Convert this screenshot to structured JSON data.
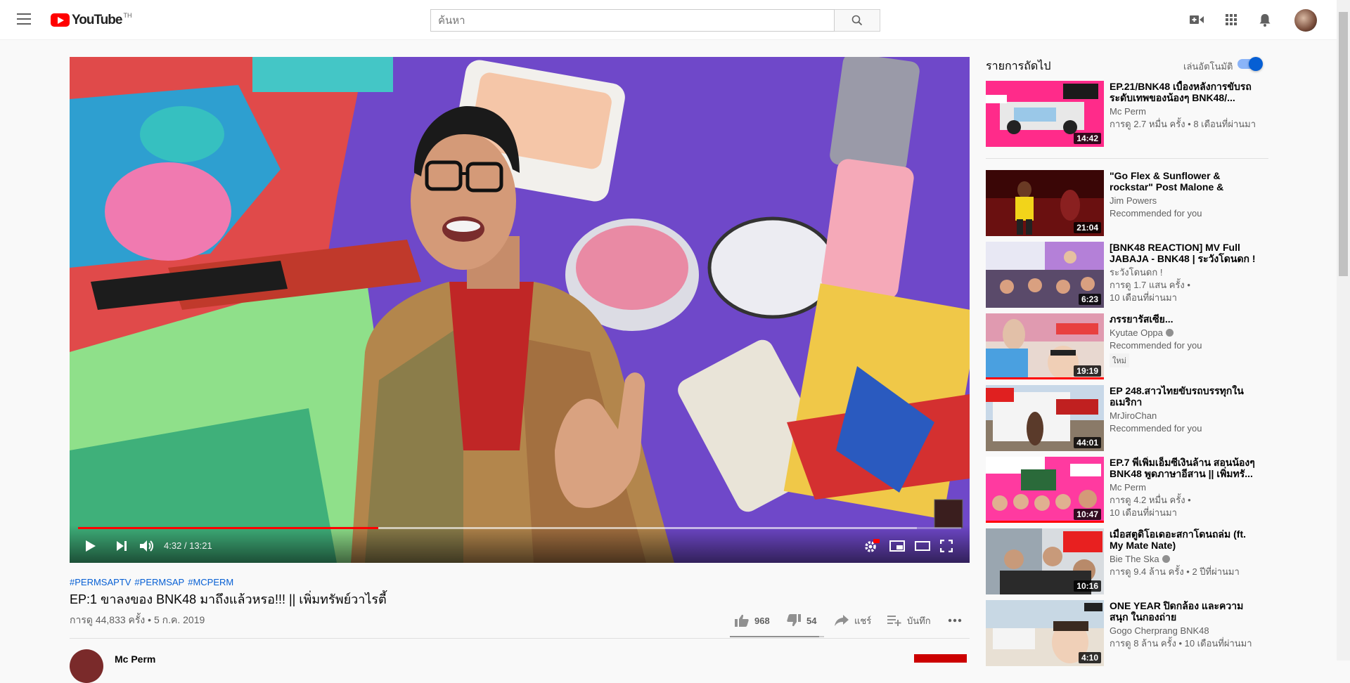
{
  "header": {
    "logo_text": "YouTube",
    "logo_region": "TH",
    "search_placeholder": "ค้นหา"
  },
  "player": {
    "current_time": "4:32",
    "separator": " / ",
    "duration": "13:21",
    "progress": 0.34,
    "buffered": 0.95
  },
  "video": {
    "hashtags": [
      "#PERMSAPTV",
      "#PERMSAP",
      "#MCPERM"
    ],
    "title": "EP:1 ขาลงของ BNK48 มาถึงแล้วหรอ!!! || เพิ่มทรัพย์วาไรตี้",
    "views_date": "การดู 44,833 ครั้ง • 5 ก.ค. 2019",
    "likes": "968",
    "dislikes": "54",
    "share_label": "แชร์",
    "save_label": "บันทึก",
    "like_ratio": 0.95
  },
  "channel": {
    "name": "Mc Perm"
  },
  "sidebar": {
    "up_next_label": "รายการถัดไป",
    "autoplay_label": "เล่นอัตโนมัติ",
    "autoplay_on": true,
    "videos": [
      {
        "title": "EP.21/BNK48 เบื้องหลังการขับรถ ระดับเทพของน้องๆ BNK48/...",
        "channel": "Mc Perm",
        "meta": "การดู 2.7 หมื่น ครั้ง • 8 เดือนที่ผ่านมา",
        "duration": "14:42"
      },
      {
        "title": "\"Go Flex & Sunflower & rockstar\" Post Malone & Swae...",
        "channel": "Jim Powers",
        "meta": "Recommended for you",
        "duration": "21:04"
      },
      {
        "title": "[BNK48 REACTION] MV Full JABAJA - BNK48 | ระวังโดนดก !",
        "channel": "ระวังโดนดก !",
        "meta": "การดู 1.7 แสน ครั้ง •",
        "meta2": "10 เดือนที่ผ่านมา",
        "duration": "6:23"
      },
      {
        "title": "ภรรยารัสเซีย...",
        "channel": "Kyutae Oppa",
        "meta": "Recommended for you",
        "badge": "ใหม่",
        "duration": "19:19"
      },
      {
        "title": "EP 248.สาวไทยขับรถบรรทุกใน อเมริกา",
        "channel": "MrJiroChan",
        "meta": "Recommended for you",
        "duration": "44:01"
      },
      {
        "title": "EP.7 พี่เพิ่มเอ็มซีเงินล้าน สอนน้องๆ BNK48 พูดภาษาอีสาน || เพิ่มทรั...",
        "channel": "Mc Perm",
        "meta": "การดู 4.2 หมื่น ครั้ง •",
        "meta2": "10 เดือนที่ผ่านมา",
        "duration": "10:47"
      },
      {
        "title": "เมื่อสตูดิโอเดอะสกาโดนถล่ม (ft. My Mate Nate)",
        "channel": "Bie The Ska",
        "meta": "การดู 9.4 ล้าน ครั้ง • 2 ปีที่ผ่านมา",
        "duration": "10:16"
      },
      {
        "title": "ONE YEAR ปิดกล้อง และความสนุก ในกองถ่าย",
        "channel": "Gogo Cherprang BNK48",
        "meta": "การดู 8 ล้าน ครั้ง • 10 เดือนที่ผ่านมา",
        "duration": "4:10"
      }
    ]
  },
  "colors": {
    "brand_red": "#ff0000",
    "link_blue": "#065fd4",
    "text_secondary": "#606060"
  }
}
